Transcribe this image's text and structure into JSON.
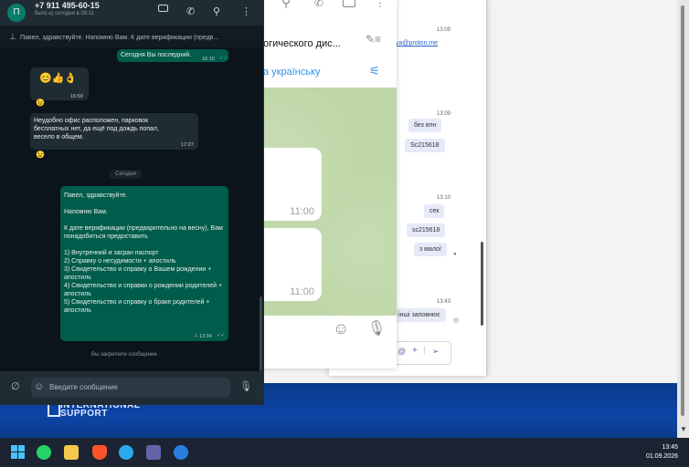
{
  "whatsapp": {
    "contact_initial": "П",
    "contact_name": "+7 911 495-60-15",
    "contact_status": "был(-а) сегодня в 08:11",
    "pinned_preview": "Павел, здравствуйте. Напомню Вам. К дате верификации (предв...",
    "messages": {
      "out1_text": "Сегодня Вы последний.",
      "out1_time": "16:15",
      "in1_emoji": "😊👍👌",
      "in1_time": "16:59",
      "in2_text": "Неудобно офис расположен, парковок бесплатных нет, да ещё под дождь попал, весело в общем.",
      "in2_time": "17:27",
      "date_sep": "Сегодня",
      "out2_line1": "Павел, здравствуйте.",
      "out2_line2": "Напомню Вам.",
      "out2_line3": "К дате верификации (предварительно на весну), Вам понадобиться предоставить",
      "out2_item1": "1) Внутренний и загран паспорт",
      "out2_item2": "2) Справку о несудимости + апостиль",
      "out2_item3": "3) Свидетельство  и справку о Вашем рождении + апостиль",
      "out2_item4": "4) Свидетельство и справки о рождении родителей + апостиль",
      "out2_item5": "5) Свидетельство и справку о браке родителей + апостиль",
      "out2_time": "13:34",
      "pinned_notice": "Вы закрепили сообщение"
    },
    "input_placeholder": "Введите сообщение"
  },
  "telegram": {
    "chat_title": "огического дис...",
    "translate_label": "а українську",
    "bubble1_time": "11:00",
    "bubble2_time": "11:00"
  },
  "email_window": {
    "time1": "13:09",
    "link": "ya@proton.me",
    "time2": "13:09",
    "msg1": "без впн",
    "msg2": "Sc215618",
    "time3": "13:10",
    "msg3": "сек",
    "msg4": "sc215618",
    "msg5": "з малої",
    "time4": "13:43",
    "msg6": "інші заповнює"
  },
  "desktop": {
    "logo_line1": "INTERNATIONAL",
    "logo_line2": "SUPPORT"
  },
  "taskbar": {
    "time": "13:45",
    "date": "01.09.2026"
  }
}
